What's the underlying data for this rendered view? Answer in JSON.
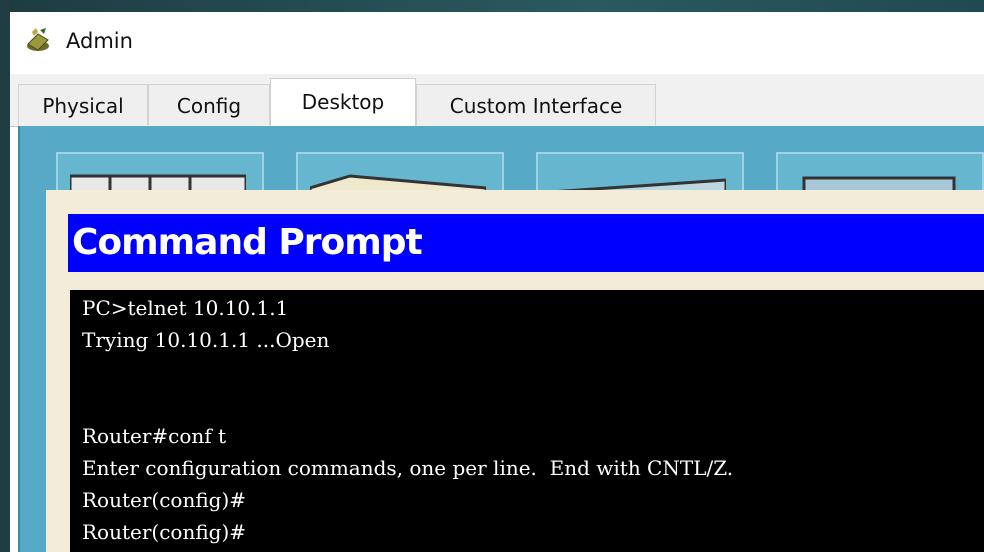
{
  "window": {
    "title": "Admin",
    "icon": "router-icon"
  },
  "tabs": [
    {
      "label": "Physical",
      "active": false
    },
    {
      "label": "Config",
      "active": false
    },
    {
      "label": "Desktop",
      "active": true
    },
    {
      "label": "Custom Interface",
      "active": false
    }
  ],
  "panel": {
    "title": "Command Prompt",
    "header_color": "#0000ff"
  },
  "terminal": {
    "lines": [
      "PC>telnet 10.10.1.1",
      "Trying 10.10.1.1 ...Open",
      "",
      "",
      "Router#conf t",
      "Enter configuration commands, one per line.  End with CNTL/Z.",
      "Router(config)#",
      "Router(config)#"
    ]
  },
  "colors": {
    "desktop_bg": "#56a9c7",
    "panel_bg": "#f2ecd8",
    "terminal_bg": "#000000"
  }
}
